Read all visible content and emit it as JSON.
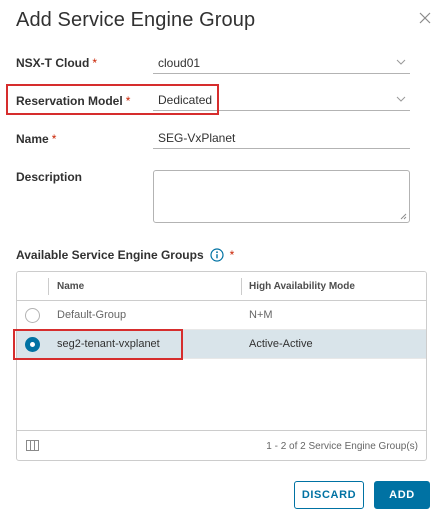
{
  "dialog": {
    "title": "Add Service Engine Group"
  },
  "form": {
    "cloud": {
      "label": "NSX-T Cloud",
      "required": "*",
      "value": "cloud01"
    },
    "reservation": {
      "label": "Reservation Model",
      "required": "*",
      "value": "Dedicated"
    },
    "name": {
      "label": "Name",
      "required": "*",
      "value": "SEG-VxPlanet"
    },
    "description": {
      "label": "Description",
      "value": ""
    }
  },
  "seg_grid": {
    "label": "Available Service Engine Groups",
    "required": "*",
    "columns": [
      "Name",
      "High Availability Mode"
    ],
    "rows": [
      {
        "name": "Default-Group",
        "ha_mode": "N+M",
        "selected": false
      },
      {
        "name": "seg2-tenant-vxplanet",
        "ha_mode": "Active-Active",
        "selected": true
      }
    ],
    "footer": "1 - 2 of 2 Service Engine Group(s)"
  },
  "actions": {
    "discard_label": "DISCARD",
    "add_label": "ADD"
  },
  "colors": {
    "accent": "#0072a3",
    "highlight": "#d62d2d",
    "required": "#c92100",
    "selected_row": "#d9e4ea"
  }
}
